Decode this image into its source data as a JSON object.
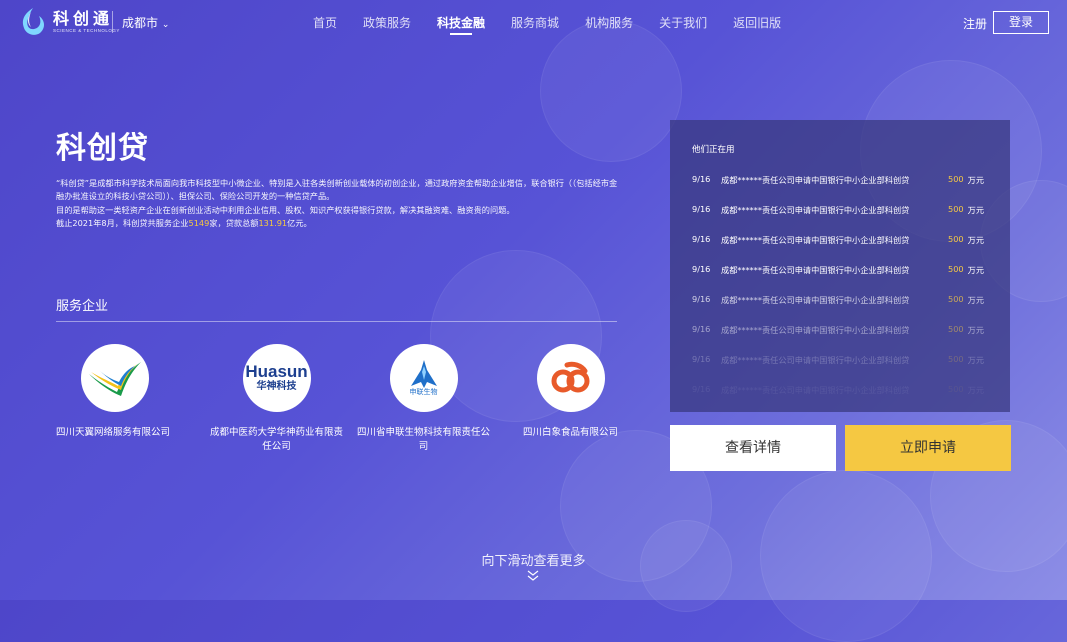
{
  "header": {
    "brand_name": "科创通",
    "brand_sub": "SCIENCE & TECHNOLOGY",
    "city": "成都市",
    "nav": [
      {
        "label": "首页",
        "active": false
      },
      {
        "label": "政策服务",
        "active": false
      },
      {
        "label": "科技金融",
        "active": true
      },
      {
        "label": "服务商城",
        "active": false
      },
      {
        "label": "机构服务",
        "active": false
      },
      {
        "label": "关于我们",
        "active": false
      },
      {
        "label": "返回旧版",
        "active": false
      }
    ],
    "register_label": "注册",
    "login_label": "登录"
  },
  "main": {
    "title": "科创贷",
    "desc_line1": "“科创贷”是成都市科学技术局面向我市科技型中小微企业、特别是入驻各类创新创业载体的初创企业，通过政府资金帮助企业增信，联合银行（（包括经市金融办批准设立的科技小贷公司））、担保公司、保险公司开发的一种信贷产品。",
    "desc_line2": "目的是帮助这一类轻资产企业在创新创业活动中利用企业信用、股权、知识产权获得银行贷款，解决其融资难、融资贵的问题。",
    "desc_line3_a": "截止2021年8月，科创贷共服务企业",
    "desc_line3_companies": "5149",
    "desc_line3_b": "家，贷款总额",
    "desc_line3_amount": "131.91",
    "desc_line3_c": "亿元。",
    "section_title": "服务企业",
    "companies": [
      {
        "name": "四川天翼网络服务有限公司",
        "logo": "tianyi-logo"
      },
      {
        "name": "成都中医药大学华神药业有限责任公司",
        "logo": "huasun-logo",
        "logo_text": "Huasun",
        "logo_sub": "华神科技"
      },
      {
        "name": "四川省申联生物科技有限责任公司",
        "logo": "shenlian-logo",
        "logo_sub": "申联生物"
      },
      {
        "name": "四川白象食品有限公司",
        "logo": "baixiang-logo"
      }
    ]
  },
  "panel": {
    "title": "他们正在用",
    "rows": [
      {
        "date": "9/16",
        "text": "成都******责任公司申请中国银行中小企业部科创贷",
        "amount": "500",
        "unit": "万元",
        "opacity": 1
      },
      {
        "date": "9/16",
        "text": "成都******责任公司申请中国银行中小企业部科创贷",
        "amount": "500",
        "unit": "万元",
        "opacity": 1
      },
      {
        "date": "9/16",
        "text": "成都******责任公司申请中国银行中小企业部科创贷",
        "amount": "500",
        "unit": "万元",
        "opacity": 1
      },
      {
        "date": "9/16",
        "text": "成都******责任公司申请中国银行中小企业部科创贷",
        "amount": "500",
        "unit": "万元",
        "opacity": 1
      },
      {
        "date": "9/16",
        "text": "成都******责任公司申请中国银行中小企业部科创贷",
        "amount": "500",
        "unit": "万元",
        "opacity": 0.75
      },
      {
        "date": "9/16",
        "text": "成都******责任公司申请中国银行中小企业部科创贷",
        "amount": "500",
        "unit": "万元",
        "opacity": 0.5
      },
      {
        "date": "9/16",
        "text": "成都******责任公司申请中国银行中小企业部科创贷",
        "amount": "500",
        "unit": "万元",
        "opacity": 0.25
      },
      {
        "date": "9/16",
        "text": "成都******责任公司申请中国银行中小企业部科创贷",
        "amount": "500",
        "unit": "万元",
        "opacity": 0.08
      }
    ],
    "detail_button": "查看详情",
    "apply_button": "立即申请"
  },
  "scroll_hint": "向下滑动查看更多",
  "colors": {
    "accent": "#f5c842",
    "bg": "#5753d6",
    "panel": "#37377d"
  }
}
